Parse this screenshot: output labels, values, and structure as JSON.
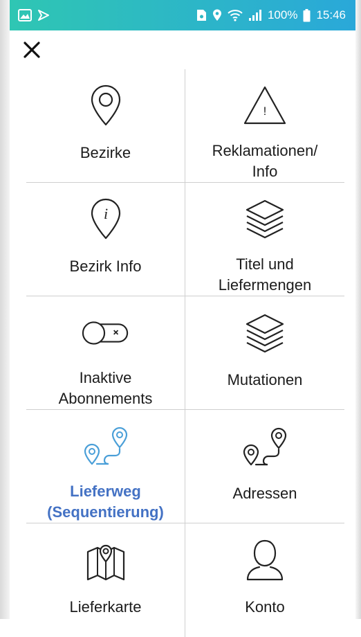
{
  "status_bar": {
    "battery": "100%",
    "time": "15:46"
  },
  "colors": {
    "status_gradient_start": "#2fc6b3",
    "status_gradient_end": "#2aa8d9",
    "active_label": "#4472c4",
    "active_icon": "#4a9fd8",
    "icon_default": "#222222"
  },
  "menu": {
    "close_icon": "close-icon",
    "items": [
      {
        "label": "Bezirke",
        "icon": "location-pin-icon",
        "active": false
      },
      {
        "label": "Reklamationen/\nInfo",
        "icon": "warning-triangle-icon",
        "active": false
      },
      {
        "label": "Bezirk Info",
        "icon": "info-pin-icon",
        "active": false
      },
      {
        "label": "Titel und\nLiefermengen",
        "icon": "layers-icon",
        "active": false
      },
      {
        "label": "Inaktive\nAbonnements",
        "icon": "toggle-off-icon",
        "active": false
      },
      {
        "label": "Mutationen",
        "icon": "layers-icon",
        "active": false
      },
      {
        "label": "Lieferweg\n(Sequentierung)",
        "icon": "route-icon",
        "active": true
      },
      {
        "label": "Adressen",
        "icon": "route-icon",
        "active": false
      },
      {
        "label": "Lieferkarte",
        "icon": "map-pin-icon",
        "active": false
      },
      {
        "label": "Konto",
        "icon": "user-icon",
        "active": false
      }
    ]
  }
}
